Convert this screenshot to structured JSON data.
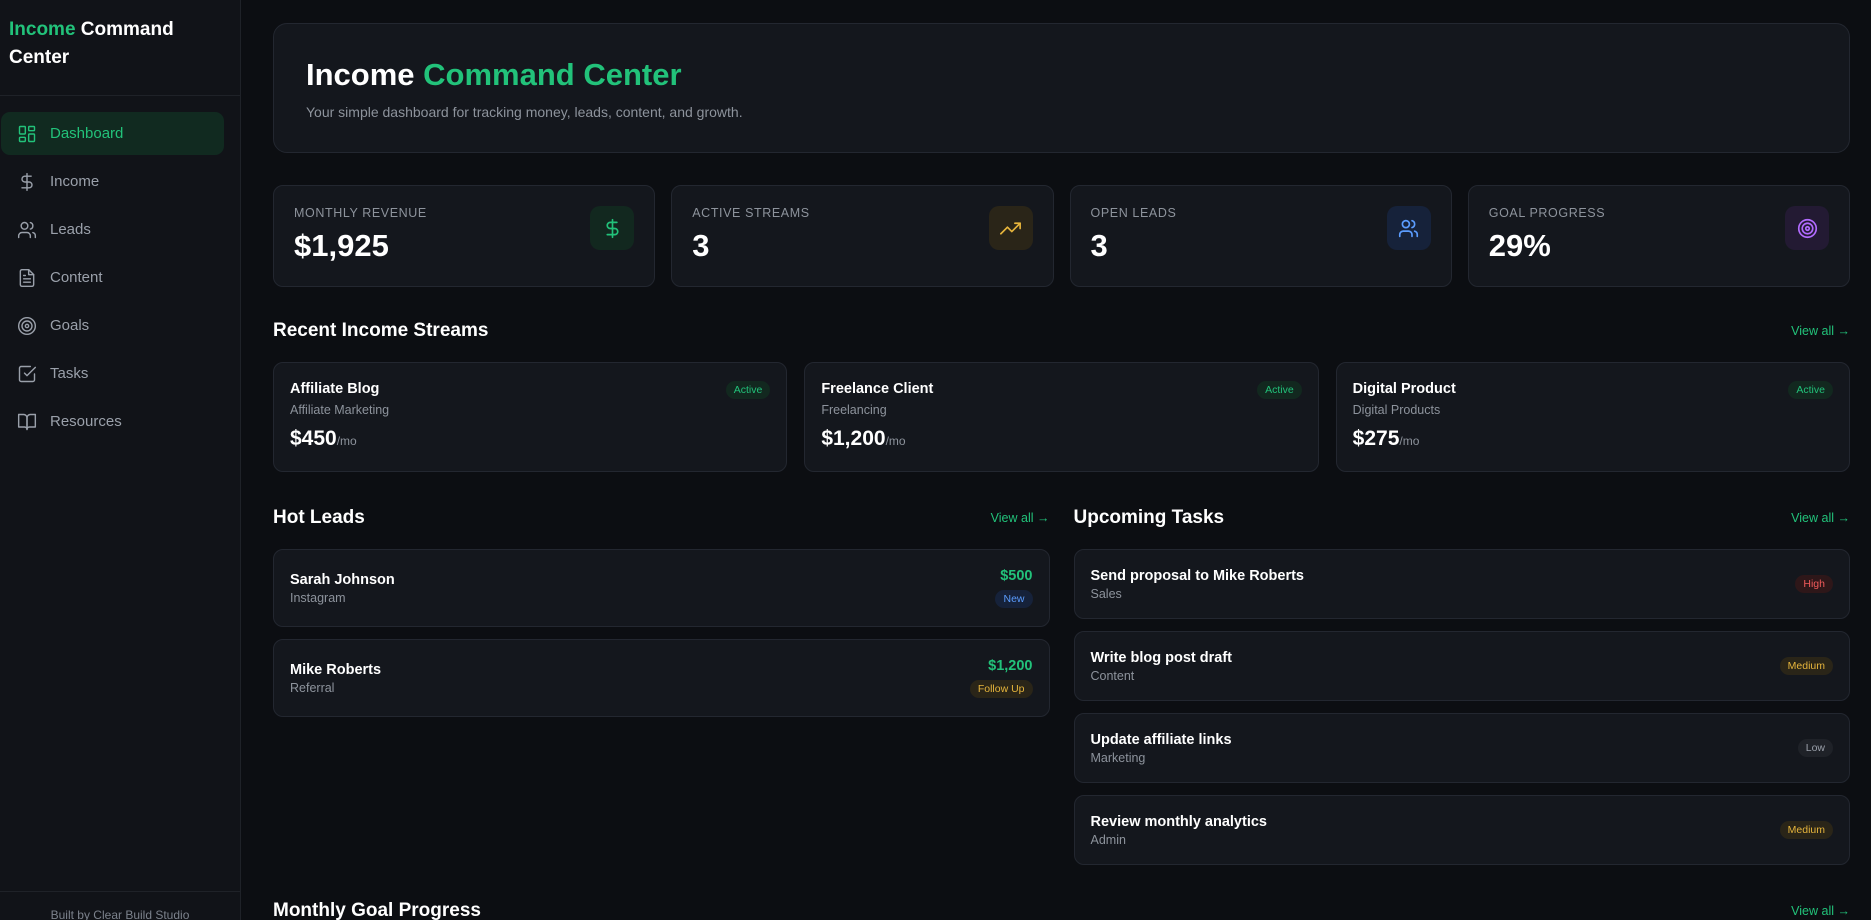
{
  "brand": {
    "accent": "Income",
    "rest": " Command Center"
  },
  "nav": [
    {
      "label": "Dashboard",
      "icon": "dashboard-icon",
      "active": true
    },
    {
      "label": "Income",
      "icon": "dollar-icon"
    },
    {
      "label": "Leads",
      "icon": "users-icon"
    },
    {
      "label": "Content",
      "icon": "document-icon"
    },
    {
      "label": "Goals",
      "icon": "target-icon"
    },
    {
      "label": "Tasks",
      "icon": "checkbox-icon"
    },
    {
      "label": "Resources",
      "icon": "book-icon"
    }
  ],
  "footer": "Built by Clear Build Studio",
  "hero": {
    "title_plain": "Income ",
    "title_accent": "Command Center",
    "subtitle": "Your simple dashboard for tracking money, leads, content, and growth."
  },
  "stats": [
    {
      "label": "MONTHLY REVENUE",
      "value": "$1,925",
      "icon": "dollar-icon",
      "color": "#22c27a",
      "bg": "#12281f"
    },
    {
      "label": "ACTIVE STREAMS",
      "value": "3",
      "icon": "trending-up-icon",
      "color": "#e6b53c",
      "bg": "#2a2518"
    },
    {
      "label": "OPEN LEADS",
      "value": "3",
      "icon": "users-icon",
      "color": "#5b9dff",
      "bg": "#16223a"
    },
    {
      "label": "GOAL PROGRESS",
      "value": "29%",
      "icon": "target-icon",
      "color": "#b26bff",
      "bg": "#231a33"
    }
  ],
  "streams_section": {
    "title": "Recent Income Streams",
    "view_all": "View all →"
  },
  "streams": [
    {
      "name": "Affiliate Blog",
      "category": "Affiliate Marketing",
      "amount": "$450",
      "per": "/mo",
      "status": "Active"
    },
    {
      "name": "Freelance Client",
      "category": "Freelancing",
      "amount": "$1,200",
      "per": "/mo",
      "status": "Active"
    },
    {
      "name": "Digital Product",
      "category": "Digital Products",
      "amount": "$275",
      "per": "/mo",
      "status": "Active"
    }
  ],
  "leads_section": {
    "title": "Hot Leads",
    "view_all": "View all →"
  },
  "leads": [
    {
      "name": "Sarah Johnson",
      "source": "Instagram",
      "amount": "$500",
      "status": "New",
      "status_color": "#5b9dff",
      "status_bg": "#16223a"
    },
    {
      "name": "Mike Roberts",
      "source": "Referral",
      "amount": "$1,200",
      "status": "Follow Up",
      "status_color": "#e6b53c",
      "status_bg": "#2a2518"
    }
  ],
  "tasks_section": {
    "title": "Upcoming Tasks",
    "view_all": "View all →"
  },
  "tasks": [
    {
      "name": "Send proposal to Mike Roberts",
      "category": "Sales",
      "priority": "High",
      "color": "#f05a5a",
      "bg": "#2e1719"
    },
    {
      "name": "Write blog post draft",
      "category": "Content",
      "priority": "Medium",
      "color": "#e6b53c",
      "bg": "#2a2518"
    },
    {
      "name": "Update affiliate links",
      "category": "Marketing",
      "priority": "Low",
      "color": "#9aa0aa",
      "bg": "#1f2228"
    },
    {
      "name": "Review monthly analytics",
      "category": "Admin",
      "priority": "Medium",
      "color": "#e6b53c",
      "bg": "#2a2518"
    }
  ],
  "goal_section": {
    "title": "Monthly Goal Progress",
    "view_all": "View all →"
  }
}
